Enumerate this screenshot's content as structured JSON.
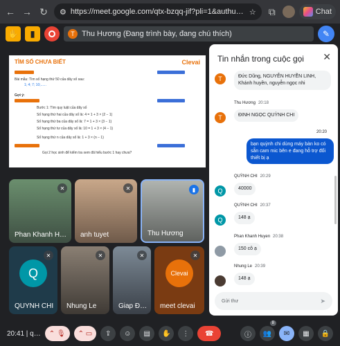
{
  "browser": {
    "url": "https://meet.google.com/qtx-bzqq-jif?pli=1&authus…",
    "chat_label": "Chat"
  },
  "meet_top": {
    "presenter_initial": "T",
    "presenter_text": "Thu Hương (Đang trình bày, đang chú thích)"
  },
  "slide": {
    "title": "TÌM SỐ CHƯA BIẾT",
    "logo": "Clevai",
    "lines": [
      "Bài mẫu: Tìm số hạng thứ 50 của dãy số sau:",
      "1; 4; 7; 10;......",
      "Gợi ý:",
      "Bước 1: Tìm quy luật của dãy số",
      "Số hạng thứ hai của dãy số là: 4 = 1 + 3 × (2 − 1)",
      "Số hạng thứ ba của dãy số là: 7 = 1 + 3 × (3 − 1)",
      "Số hạng thứ tư của dãy số là: 10 = 1 + 3 × (4 − 1)",
      "Số hạng thứ n của dãy số là: 1 + 3 × (n − 1)",
      "Gọi 2 học sinh để kiểm tra xem đã hiểu bước 1 hay chưa?"
    ]
  },
  "tiles": [
    {
      "name": "Phan Khanh H…"
    },
    {
      "name": "anh tuyet"
    },
    {
      "name": "Thu Hương"
    },
    {
      "name": "QUYNH CHI",
      "initial": "Q"
    },
    {
      "name": "Nhung Le"
    },
    {
      "name": "Giap Đ…"
    },
    {
      "name": "meet clevai",
      "initial": "Clevai"
    }
  ],
  "chat": {
    "header": "Tin nhắn trong cuộc gọi",
    "input_placeholder": "Gửi thư",
    "messages": [
      {
        "initial": "T",
        "text": "Đức Dũng, NGUYỄN HUYỀN LINH, Khánh huyền, nguyễn ngọc nhi"
      },
      {
        "initial": "T",
        "name": "Thu Hương",
        "time": "20:18",
        "text": "ĐINH NGỌC QUỲNH CHI"
      },
      {
        "time": "20:20",
        "text": "bạn quỳnh chi dùng máy bàn ko có sẵn cam mic bên e đang hỗ trợ đổi thiết bị ạ"
      },
      {
        "initial": "Q",
        "name": "QUỲNH CHI",
        "time": "20:29",
        "text": "40000"
      },
      {
        "initial": "Q",
        "name": "QUỲNH CHI",
        "time": "20:37",
        "text": "148 ạ"
      },
      {
        "name": "Phan Khanh Huyen",
        "time": "20:38",
        "text": "150 cô ạ"
      },
      {
        "name": "Nhung Le",
        "time": "20:39",
        "text": "148 ạ"
      }
    ]
  },
  "bottom": {
    "clock": "20:41 | q…",
    "participants_count": "8"
  }
}
